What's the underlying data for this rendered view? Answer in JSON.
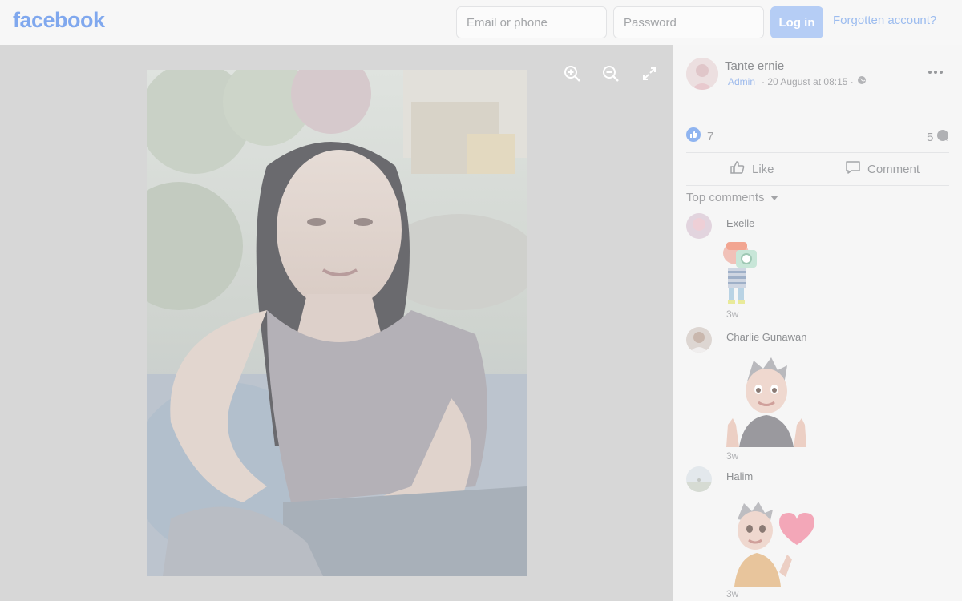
{
  "header": {
    "logo": "facebook",
    "email_placeholder": "Email or phone",
    "password_placeholder": "Password",
    "login_label": "Log in",
    "forgot_label": "Forgotten account?"
  },
  "viewer": {
    "tools": [
      "zoom-in-icon",
      "zoom-out-icon",
      "fullscreen-icon"
    ]
  },
  "post": {
    "author": "Tante ernie",
    "role": "Admin",
    "date": "· 20 August at 08:15 ·",
    "privacy_icon": "globe-icon",
    "like_count": "7",
    "comment_count": "5",
    "like_label": "Like",
    "comment_label": "Comment",
    "top_comments_label": "Top comments"
  },
  "comments": [
    {
      "name": "Exelle",
      "time": "3w",
      "sticker": "camera-character-sticker"
    },
    {
      "name": "Charlie Gunawan",
      "time": "3w",
      "sticker": "thumbs-up-avatar-sticker"
    },
    {
      "name": "Halim",
      "time": "3w",
      "sticker": "heart-avatar-sticker"
    }
  ],
  "colors": {
    "brand": "#80a8ee",
    "login_button": "#b5cdf5",
    "viewer_bg": "#d7d7d7"
  }
}
